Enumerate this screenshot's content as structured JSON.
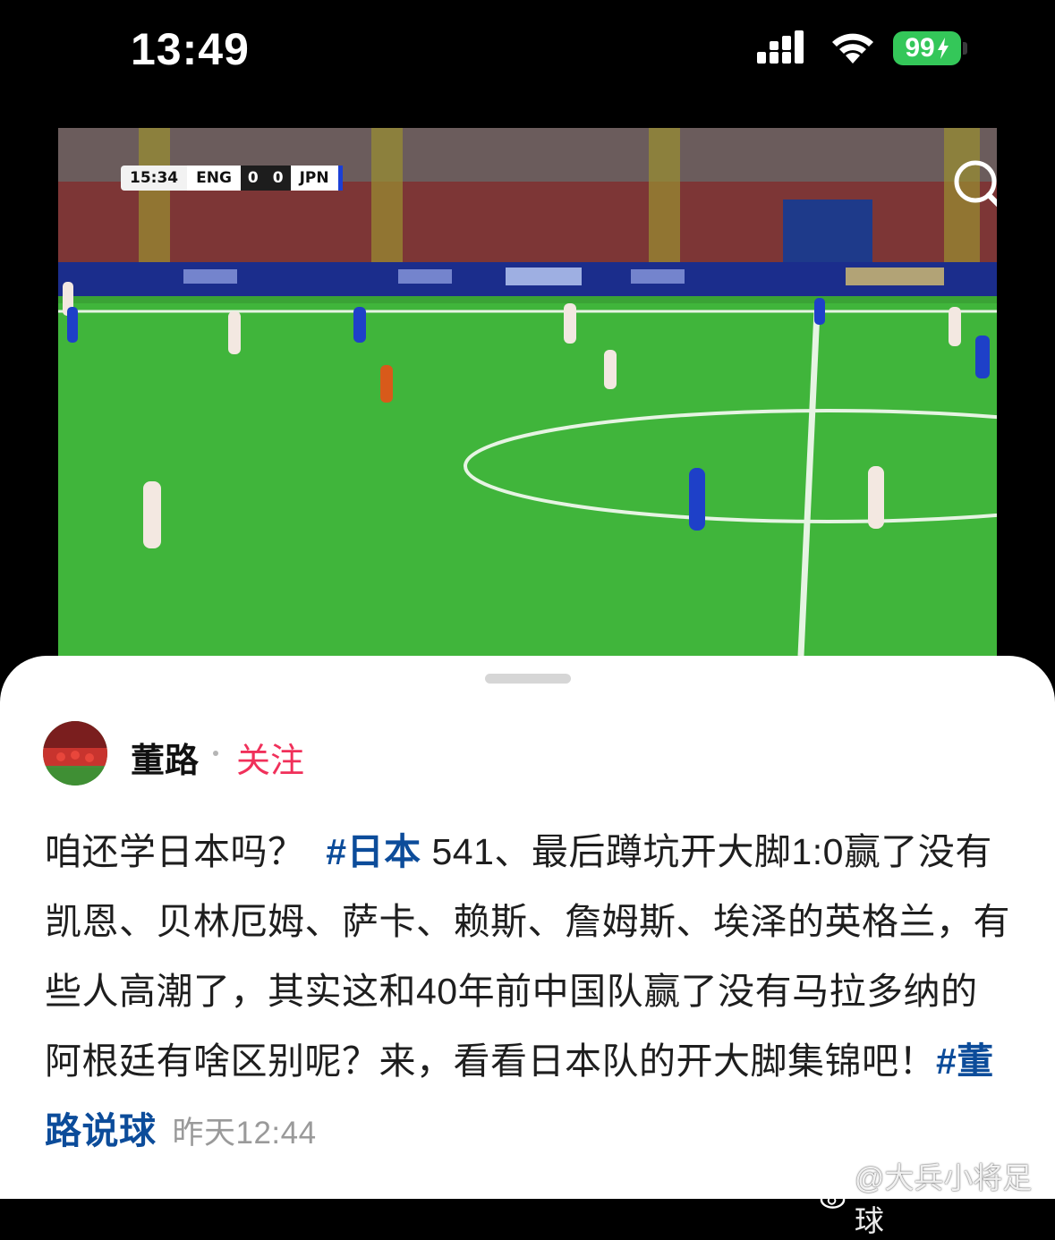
{
  "status_bar": {
    "time": "13:49",
    "battery": "99"
  },
  "video": {
    "scoreboard": {
      "clock": "15:34",
      "home_team": "ENG",
      "home_score": "0",
      "away_score": "0",
      "away_team": "JPN"
    },
    "icons": [
      "search-icon"
    ]
  },
  "post": {
    "username": "董路",
    "follow_label": "关注",
    "text_intro": "咱还学日本吗？",
    "hashtag_1": "#日本",
    "text_body": " 541、最后蹲坑开大脚1:0赢了没有凯恩、贝林厄姆、萨卡、赖斯、詹姆斯、埃泽的英格兰，有些人高潮了，其实这和40年前中国队赢了没有马拉多纳的阿根廷有啥区别呢？来，看看日本队的开大脚集锦吧！",
    "hashtag_2": "#董路说球",
    "timestamp": "昨天12:44"
  },
  "watermark": "@大兵小将足球",
  "colors": {
    "follow": "#f0305a",
    "hashtag": "#0c4c9a",
    "battery": "#34c759",
    "pitch": "#3fae3a"
  }
}
